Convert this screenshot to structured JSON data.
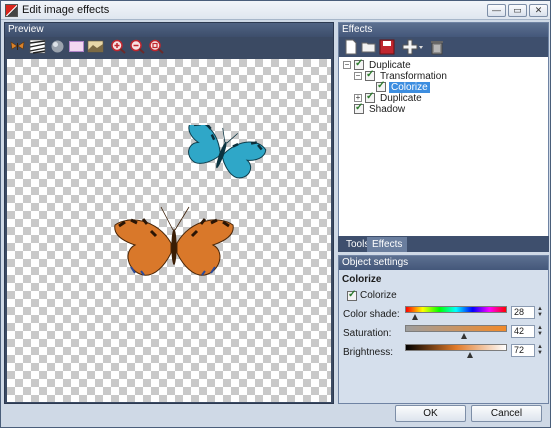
{
  "window": {
    "title": "Edit image effects"
  },
  "title_buttons": {
    "minimize": "—",
    "maximize": "▭",
    "close": "✕"
  },
  "preview": {
    "header": "Preview",
    "toolbar_icons": [
      "butterfly-icon",
      "zebra-texture-icon",
      "sphere-icon",
      "rectangle-icon",
      "landscape-icon",
      "zoom-in-icon",
      "zoom-out-icon",
      "zoom-fit-icon"
    ]
  },
  "effects": {
    "header": "Effects",
    "toolbar_icons": [
      "new-file-icon",
      "open-folder-icon",
      "save-icon",
      "add-effect-icon",
      "delete-icon"
    ],
    "tree": [
      {
        "label": "Duplicate",
        "level": 0,
        "expander": "−",
        "checked": true,
        "selected": false
      },
      {
        "label": "Transformation",
        "level": 1,
        "expander": "−",
        "checked": true,
        "selected": false
      },
      {
        "label": "Colorize",
        "level": 2,
        "expander": "",
        "checked": true,
        "selected": true
      },
      {
        "label": "Duplicate",
        "level": 1,
        "expander": "+",
        "checked": true,
        "selected": false
      },
      {
        "label": "Shadow",
        "level": 0,
        "expander": "",
        "checked": true,
        "selected": false
      }
    ]
  },
  "tabs": [
    {
      "label": "Tools",
      "active": false
    },
    {
      "label": "Effects",
      "active": true
    }
  ],
  "object_settings": {
    "header": "Object settings",
    "title": "Colorize",
    "colorize_label": "Colorize",
    "colorize_checked": true,
    "sliders": [
      {
        "label": "Color shade:",
        "value": "28",
        "fraction": 0.1
      },
      {
        "label": "Saturation:",
        "value": "42",
        "fraction": 0.58
      },
      {
        "label": "Brightness:",
        "value": "72",
        "fraction": 0.64
      }
    ]
  },
  "buttons": {
    "ok": "OK",
    "cancel": "Cancel"
  },
  "colors": {
    "butterfly_top": "#2fa7c8",
    "butterfly_bottom": "#d9782a",
    "selection": "#3d8ee0",
    "panel_dark": "#3b4a63"
  }
}
